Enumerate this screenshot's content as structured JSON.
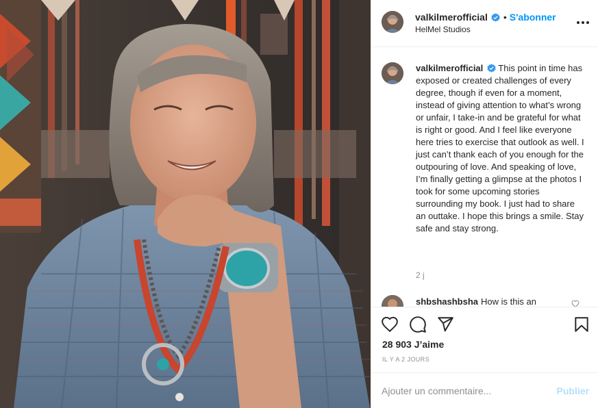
{
  "post": {
    "username": "valkilmerofficial",
    "separator": "•",
    "follow_label": "S'abonner",
    "location": "HelMel Studios",
    "photo_name": "portrait photo",
    "caption": "This point in time has exposed or created challenges of every degree, though if even for a moment, instead of giving attention to what’s wrong or unfair, I take-in and be grateful for what is right or good. And I feel like everyone here tries to exercise that outlook as well. I just can’t thank each of you enough for the outpouring of love. And speaking of love, I’m finally getting a glimpse at the photos I took for some upcoming stories surrounding my book. I just had to share an outtake. I hope this brings a smile. Stay safe and stay strong.",
    "caption_time": "2 j",
    "likes": "28 903 J’aime",
    "date": "IL Y A 2 JOURS"
  },
  "comments": [
    {
      "username": "shbshashbsha",
      "text": "How is this an"
    }
  ],
  "composer": {
    "placeholder": "Ajouter un commentaire...",
    "publish_label": "Publier"
  },
  "icons": {
    "like": "heart-icon",
    "comment": "comment-icon",
    "share": "share-icon",
    "save": "bookmark-icon",
    "more": "more-options-icon",
    "verified": "verified-badge-icon"
  },
  "colors": {
    "accent": "#0095f6",
    "publish_disabled": "#b2dffc",
    "muted": "#8e8e8e",
    "text": "#262626"
  }
}
